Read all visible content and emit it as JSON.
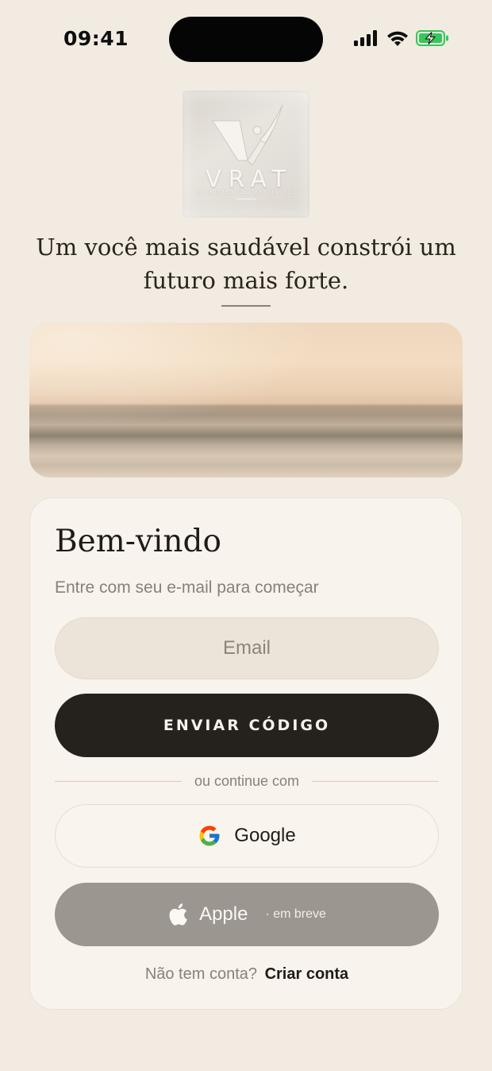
{
  "status_bar": {
    "time": "09:41",
    "icons": [
      "signal-icon",
      "wifi-icon",
      "battery-charging-icon"
    ],
    "battery_color": "#34c759"
  },
  "brand": {
    "logo_text": "VRAT",
    "logo_tagline": "COMMITTED TO A BETTER YOU"
  },
  "tagline": "Um você mais saudável constrói um futuro mais forte.",
  "login": {
    "title": "Bem-vindo",
    "subtitle": "Entre com seu e-mail para começar",
    "email_placeholder": "Email",
    "email_value": "",
    "send_code_label": "ENVIAR CÓDIGO",
    "divider_text": "ou continue com",
    "google_label": "Google",
    "apple_label": "Apple",
    "apple_status": "· em breve",
    "signup_prompt": "Não tem conta?",
    "signup_link": "Criar conta"
  },
  "colors": {
    "background": "#f1ebe2",
    "card": "#f8f3ed",
    "primary_button": "#25211c",
    "disabled_button": "#9b9690"
  }
}
